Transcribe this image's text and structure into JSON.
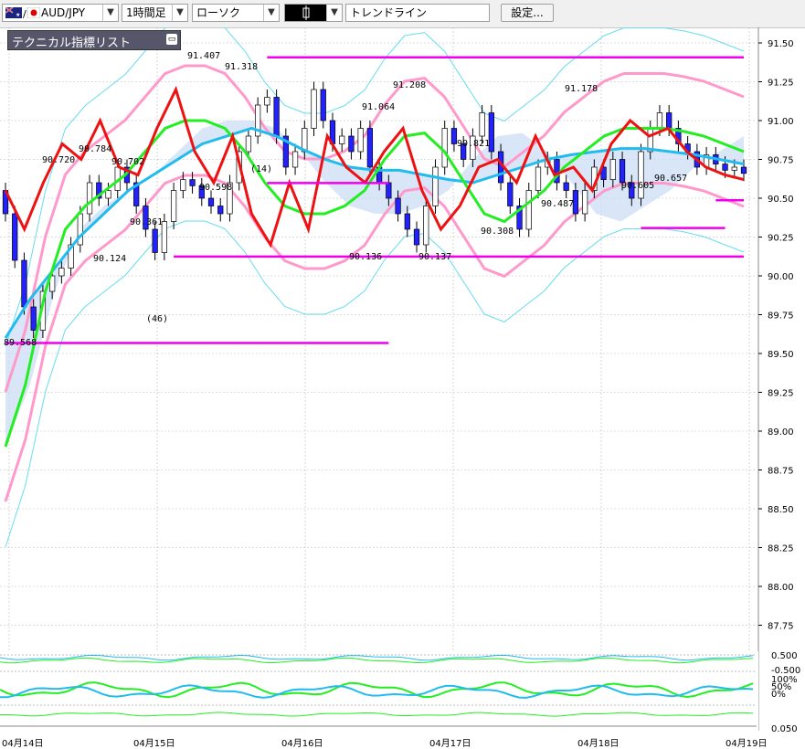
{
  "toolbar": {
    "symbol": "AUD/JPY",
    "timeframe": "1時間足",
    "chart_type": "ローソク",
    "trendline_label": "トレンドライン",
    "settings_label": "設定..."
  },
  "indicator_panel": {
    "title": "テクニカル指標リスト"
  },
  "colors": {
    "bull": "#ffffff",
    "bear": "#2222ff",
    "ma_short": "#ee1111",
    "ma_mid": "#22ee22",
    "ma_long": "#22bbee",
    "bollinger_outer": "#ff99cc",
    "bollinger_inner": "#66ddee",
    "support_resistance": "#ee00ee",
    "cloud": "#c8dcf5"
  },
  "chart_data": [
    {
      "type": "candlestick",
      "price_axis": [
        "91.50",
        "91.25",
        "91.00",
        "90.75",
        "90.50",
        "90.25",
        "90.00",
        "89.75",
        "89.50",
        "89.25",
        "89.00",
        "88.75",
        "88.50",
        "88.25",
        "88.00",
        "87.75"
      ],
      "ylim": [
        87.6,
        91.6
      ],
      "date_axis": [
        "04月14日",
        "04月15日",
        "04月16日",
        "04月17日",
        "04月18日",
        "04月19日"
      ],
      "annotations": [
        "91.407",
        "91.318",
        "91.208",
        "91.178",
        "91.064",
        "90.784",
        "90.720",
        "90.702",
        "90.821",
        "90.598",
        "90.605",
        "90.657",
        "90.487",
        "90.361",
        "90.308",
        "90.124",
        "90.136",
        "90.137",
        "89.568",
        "(14)",
        "(46)"
      ],
      "candles": [
        {
          "t": 0,
          "o": 90.55,
          "c": 90.4
        },
        {
          "t": 1,
          "o": 90.4,
          "c": 90.1
        },
        {
          "t": 2,
          "o": 90.1,
          "c": 89.8
        },
        {
          "t": 3,
          "o": 89.8,
          "c": 89.65
        },
        {
          "t": 4,
          "o": 89.65,
          "c": 89.9
        },
        {
          "t": 5,
          "o": 89.9,
          "c": 90.0
        },
        {
          "t": 6,
          "o": 90.0,
          "c": 90.05
        },
        {
          "t": 7,
          "o": 90.05,
          "c": 90.2
        },
        {
          "t": 8,
          "o": 90.2,
          "c": 90.4
        },
        {
          "t": 9,
          "o": 90.4,
          "c": 90.6
        },
        {
          "t": 10,
          "o": 90.6,
          "c": 90.5
        },
        {
          "t": 11,
          "o": 90.5,
          "c": 90.55
        },
        {
          "t": 12,
          "o": 90.55,
          "c": 90.7
        },
        {
          "t": 13,
          "o": 90.7,
          "c": 90.6
        },
        {
          "t": 14,
          "o": 90.6,
          "c": 90.45
        },
        {
          "t": 15,
          "o": 90.45,
          "c": 90.3
        },
        {
          "t": 16,
          "o": 90.3,
          "c": 90.15
        },
        {
          "t": 17,
          "o": 90.15,
          "c": 90.35
        },
        {
          "t": 18,
          "o": 90.35,
          "c": 90.55
        },
        {
          "t": 19,
          "o": 90.55,
          "c": 90.62
        },
        {
          "t": 20,
          "o": 90.62,
          "c": 90.58
        },
        {
          "t": 21,
          "o": 90.58,
          "c": 90.5
        },
        {
          "t": 22,
          "o": 90.5,
          "c": 90.45
        },
        {
          "t": 23,
          "o": 90.45,
          "c": 90.4
        },
        {
          "t": 24,
          "o": 90.4,
          "c": 90.6
        },
        {
          "t": 25,
          "o": 90.6,
          "c": 90.8
        },
        {
          "t": 26,
          "o": 90.8,
          "c": 90.9
        },
        {
          "t": 27,
          "o": 90.9,
          "c": 91.1
        },
        {
          "t": 28,
          "o": 91.1,
          "c": 91.15
        },
        {
          "t": 29,
          "o": 91.15,
          "c": 90.9
        },
        {
          "t": 30,
          "o": 90.9,
          "c": 90.7
        },
        {
          "t": 31,
          "o": 90.7,
          "c": 90.8
        },
        {
          "t": 32,
          "o": 90.8,
          "c": 90.95
        },
        {
          "t": 33,
          "o": 90.95,
          "c": 91.2
        },
        {
          "t": 34,
          "o": 91.2,
          "c": 91.0
        },
        {
          "t": 35,
          "o": 91.0,
          "c": 90.85
        },
        {
          "t": 36,
          "o": 90.85,
          "c": 90.9
        },
        {
          "t": 37,
          "o": 90.9,
          "c": 90.8
        },
        {
          "t": 38,
          "o": 90.8,
          "c": 90.95
        },
        {
          "t": 39,
          "o": 90.95,
          "c": 90.7
        },
        {
          "t": 40,
          "o": 90.7,
          "c": 90.6
        },
        {
          "t": 41,
          "o": 90.6,
          "c": 90.5
        },
        {
          "t": 42,
          "o": 90.5,
          "c": 90.4
        },
        {
          "t": 43,
          "o": 90.4,
          "c": 90.3
        },
        {
          "t": 44,
          "o": 90.3,
          "c": 90.2
        },
        {
          "t": 45,
          "o": 90.2,
          "c": 90.45
        },
        {
          "t": 46,
          "o": 90.45,
          "c": 90.7
        },
        {
          "t": 47,
          "o": 90.7,
          "c": 90.95
        },
        {
          "t": 48,
          "o": 90.95,
          "c": 90.85
        },
        {
          "t": 49,
          "o": 90.85,
          "c": 90.75
        },
        {
          "t": 50,
          "o": 90.75,
          "c": 90.9
        },
        {
          "t": 51,
          "o": 90.9,
          "c": 91.05
        },
        {
          "t": 52,
          "o": 91.05,
          "c": 90.8
        },
        {
          "t": 53,
          "o": 90.8,
          "c": 90.6
        },
        {
          "t": 54,
          "o": 90.6,
          "c": 90.45
        },
        {
          "t": 55,
          "o": 90.45,
          "c": 90.3
        },
        {
          "t": 56,
          "o": 90.3,
          "c": 90.55
        },
        {
          "t": 57,
          "o": 90.55,
          "c": 90.7
        },
        {
          "t": 58,
          "o": 90.7,
          "c": 90.75
        },
        {
          "t": 59,
          "o": 90.75,
          "c": 90.6
        },
        {
          "t": 60,
          "o": 90.6,
          "c": 90.55
        },
        {
          "t": 61,
          "o": 90.55,
          "c": 90.4
        },
        {
          "t": 62,
          "o": 90.4,
          "c": 90.55
        },
        {
          "t": 63,
          "o": 90.55,
          "c": 90.7
        },
        {
          "t": 64,
          "o": 90.7,
          "c": 90.62
        },
        {
          "t": 65,
          "o": 90.62,
          "c": 90.75
        },
        {
          "t": 66,
          "o": 90.75,
          "c": 90.6
        },
        {
          "t": 67,
          "o": 90.6,
          "c": 90.5
        },
        {
          "t": 68,
          "o": 90.5,
          "c": 90.8
        },
        {
          "t": 69,
          "o": 90.8,
          "c": 90.95
        },
        {
          "t": 70,
          "o": 90.95,
          "c": 91.05
        },
        {
          "t": 71,
          "o": 91.05,
          "c": 90.95
        },
        {
          "t": 72,
          "o": 90.95,
          "c": 90.85
        },
        {
          "t": 73,
          "o": 90.85,
          "c": 90.8
        },
        {
          "t": 74,
          "o": 90.8,
          "c": 90.7
        },
        {
          "t": 75,
          "o": 90.7,
          "c": 90.78
        },
        {
          "t": 76,
          "o": 90.78,
          "c": 90.72
        },
        {
          "t": 77,
          "o": 90.72,
          "c": 90.68
        },
        {
          "t": 78,
          "o": 90.68,
          "c": 90.7
        },
        {
          "t": 79,
          "o": 90.7,
          "c": 90.66
        }
      ],
      "ma_short": [
        90.55,
        90.3,
        90.6,
        90.85,
        90.75,
        91.0,
        90.7,
        90.65,
        90.95,
        91.2,
        90.8,
        90.6,
        90.9,
        90.4,
        90.2,
        90.6,
        90.3,
        90.9,
        90.7,
        90.6,
        90.8,
        90.95,
        90.55,
        90.3,
        90.45,
        90.7,
        90.75,
        90.6,
        90.9,
        90.65,
        90.7,
        90.55,
        90.85,
        91.0,
        90.9,
        90.95,
        90.8,
        90.7,
        90.65,
        90.62
      ],
      "ma_mid": [
        88.9,
        89.3,
        89.9,
        90.3,
        90.45,
        90.55,
        90.65,
        90.8,
        90.95,
        91.0,
        91.0,
        90.95,
        90.8,
        90.6,
        90.45,
        90.4,
        90.4,
        90.45,
        90.55,
        90.75,
        90.9,
        90.92,
        90.8,
        90.6,
        90.4,
        90.35,
        90.45,
        90.55,
        90.7,
        90.8,
        90.9,
        90.95,
        90.95,
        90.95,
        90.93,
        90.9,
        90.85,
        90.8
      ],
      "ma_long": [
        89.6,
        89.85,
        90.05,
        90.25,
        90.4,
        90.55,
        90.65,
        90.75,
        90.85,
        90.9,
        90.95,
        90.9,
        90.82,
        90.75,
        90.7,
        90.68,
        90.68,
        90.65,
        90.62,
        90.6,
        90.65,
        90.7,
        90.75,
        90.78,
        90.8,
        90.82,
        90.82,
        90.8,
        90.78,
        90.75,
        90.72
      ],
      "levels": [
        {
          "price": 91.407,
          "from": 28,
          "to": 84
        },
        {
          "price": 90.598,
          "from": 28,
          "to": 41
        },
        {
          "price": 90.487,
          "from": 76,
          "to": 84
        },
        {
          "price": 90.308,
          "from": 68,
          "to": 77
        },
        {
          "price": 90.124,
          "from": 18,
          "to": 82
        },
        {
          "price": 89.568,
          "from": 0,
          "to": 41
        }
      ]
    }
  ],
  "lower_axis": [
    "0.500",
    "-0.500",
    "100%",
    "50%",
    "0%",
    "0.050"
  ]
}
